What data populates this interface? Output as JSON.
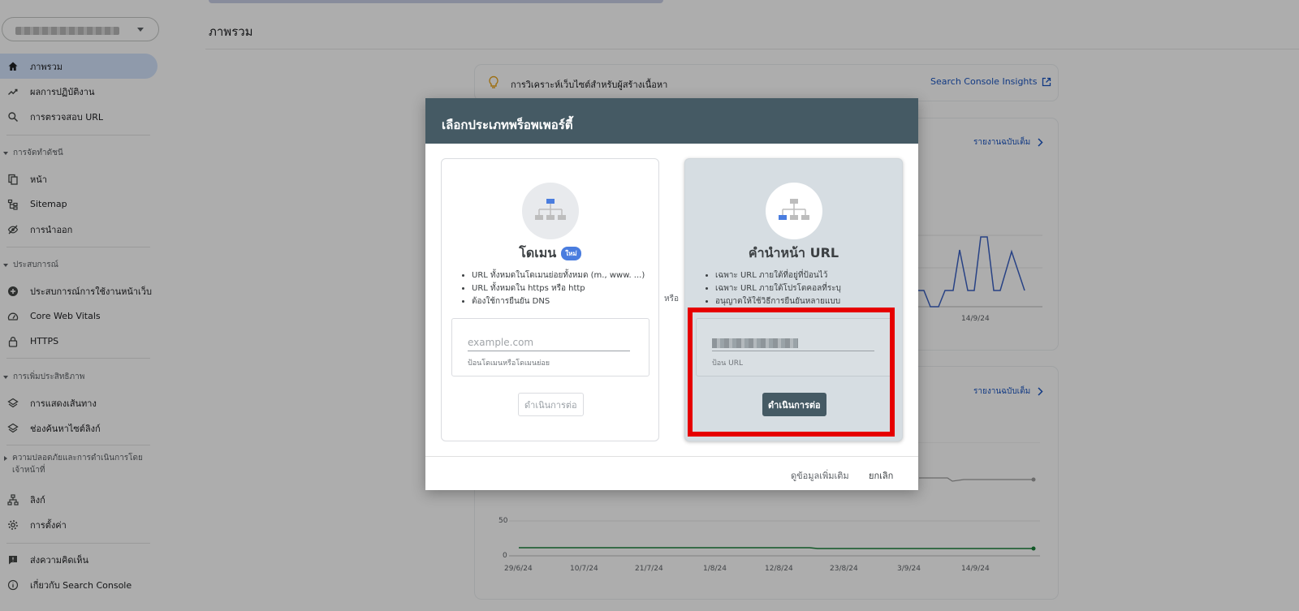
{
  "sidebar": {
    "property_selector": {
      "value_obscured": true
    },
    "items": [
      {
        "label": "ภาพรวม",
        "icon": "home-icon",
        "active": true
      },
      {
        "label": "ผลการปฏิบัติงาน",
        "icon": "trending-icon"
      },
      {
        "label": "การตรวจสอบ URL",
        "icon": "search-icon"
      }
    ],
    "sections": [
      {
        "label": "การจัดทำดัชนี",
        "items": [
          {
            "label": "หน้า",
            "icon": "pages-icon"
          },
          {
            "label": "Sitemap",
            "icon": "sitemap-icon"
          },
          {
            "label": "การนำออก",
            "icon": "hide-icon"
          }
        ]
      },
      {
        "label": "ประสบการณ์",
        "items": [
          {
            "label": "ประสบการณ์การใช้งานหน้าเว็บ",
            "icon": "plus-circle-icon"
          },
          {
            "label": "Core Web Vitals",
            "icon": "gauge-icon"
          },
          {
            "label": "HTTPS",
            "icon": "lock-icon"
          }
        ]
      },
      {
        "label": "การเพิ่มประสิทธิภาพ",
        "items": [
          {
            "label": "การแสดงเส้นทาง",
            "icon": "layers-icon"
          },
          {
            "label": "ช่องค้นหาไซต์ลิงก์",
            "icon": "layers-icon"
          }
        ]
      },
      {
        "label": "ความปลอดภัยและการดำเนินการโดยเจ้าหน้าที่"
      }
    ],
    "bottom_items": [
      {
        "label": "ลิงก์",
        "icon": "links-icon"
      },
      {
        "label": "การตั้งค่า",
        "icon": "gear-icon"
      },
      {
        "label": "ส่งความคิดเห็น",
        "icon": "feedback-icon"
      },
      {
        "label": "เกี่ยวกับ Search Console",
        "icon": "info-icon"
      }
    ]
  },
  "main": {
    "title": "ภาพรวม",
    "insight_text": "การวิเคราะห์เว็บไซต์สำหรับผู้สร้างเนื้อหา",
    "insight_link": "Search Console Insights",
    "full_report_label": "รายงานฉบับเต็ม",
    "chart1_x_tick": "14/9/24",
    "chart2_y_ticks": [
      "50",
      "0"
    ],
    "chart2_x_ticks": [
      "29/6/24",
      "10/7/24",
      "21/7/24",
      "1/8/24",
      "12/8/24",
      "23/8/24",
      "3/9/24",
      "14/9/24"
    ]
  },
  "dialog": {
    "title": "เลือกประเภทพร็อพเพอร์ตี้",
    "or_label": "หรือ",
    "domain": {
      "title": "โดเมน",
      "badge": "ใหม่",
      "bullets": [
        "URL ทั้งหมดในโดเมนย่อยทั้งหมด (m., www. ...)",
        "URL ทั้งหมดใน https หรือ http",
        "ต้องใช้การยืนยัน DNS"
      ],
      "input_placeholder": "example.com",
      "input_hint": "ป้อนโดเมนหรือโดเมนย่อย",
      "continue_label": "ดำเนินการต่อ"
    },
    "url_prefix": {
      "title": "คำนำหน้า URL",
      "bullets": [
        "เฉพาะ URL ภายใต้ที่อยู่ที่ป้อนไว้",
        "เฉพาะ URL ภายใต้โปรโตคอลที่ระบุ",
        "อนุญาตให้ใช้วิธีการยืนยันหลายแบบ"
      ],
      "input_hint": "ป้อน URL",
      "continue_label": "ดำเนินการต่อ"
    },
    "learn_more_label": "ดูข้อมูลเพิ่มเติม",
    "cancel_label": "ยกเลิก"
  },
  "colors": {
    "dialog_header": "#455a64",
    "highlight": "#e60000",
    "active_nav": "#d3e3fd",
    "chart_line_blue": "#3b62c4",
    "chart_line_green": "#188038"
  }
}
